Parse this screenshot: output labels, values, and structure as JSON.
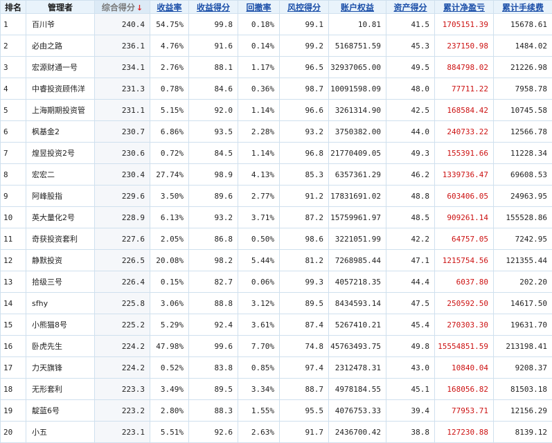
{
  "headers": {
    "rank": "排名",
    "manager": "管理者",
    "total_score": "综合得分",
    "return_rate": "收益率",
    "return_score": "收益得分",
    "drawdown": "回撤率",
    "risk_score": "风控得分",
    "equity": "账户权益",
    "asset_score": "资产得分",
    "net_profit": "累计净盈亏",
    "fees": "累计手续费"
  },
  "sort_indicator": "↓",
  "colors": {
    "header_bg": "#e9f3fb",
    "link": "#1a4ea8",
    "profit": "#cc1111",
    "sort_arrow": "#e02020"
  },
  "rows": [
    {
      "rank": "1",
      "manager": "百川爷",
      "total_score": "240.4",
      "return_rate": "54.75%",
      "return_score": "99.8",
      "drawdown": "0.18%",
      "risk_score": "99.1",
      "equity": "10.81",
      "asset_score": "41.5",
      "net_profit": "1705151.39",
      "fees": "15678.61"
    },
    {
      "rank": "2",
      "manager": "必由之路",
      "total_score": "236.1",
      "return_rate": "4.76%",
      "return_score": "91.6",
      "drawdown": "0.14%",
      "risk_score": "99.2",
      "equity": "5168751.59",
      "asset_score": "45.3",
      "net_profit": "237150.98",
      "fees": "1484.02"
    },
    {
      "rank": "3",
      "manager": "宏源财通一号",
      "total_score": "234.1",
      "return_rate": "2.76%",
      "return_score": "88.1",
      "drawdown": "1.17%",
      "risk_score": "96.5",
      "equity": "32937065.00",
      "asset_score": "49.5",
      "net_profit": "884798.02",
      "fees": "21226.98"
    },
    {
      "rank": "4",
      "manager": "中睿投资顾伟洋",
      "total_score": "231.3",
      "return_rate": "0.78%",
      "return_score": "84.6",
      "drawdown": "0.36%",
      "risk_score": "98.7",
      "equity": "10091598.09",
      "asset_score": "48.0",
      "net_profit": "77711.22",
      "fees": "7958.78"
    },
    {
      "rank": "5",
      "manager": "上海期期投资管",
      "total_score": "231.1",
      "return_rate": "5.15%",
      "return_score": "92.0",
      "drawdown": "1.14%",
      "risk_score": "96.6",
      "equity": "3261314.90",
      "asset_score": "42.5",
      "net_profit": "168584.42",
      "fees": "10745.58"
    },
    {
      "rank": "6",
      "manager": "枫基金2",
      "total_score": "230.7",
      "return_rate": "6.86%",
      "return_score": "93.5",
      "drawdown": "2.28%",
      "risk_score": "93.2",
      "equity": "3750382.00",
      "asset_score": "44.0",
      "net_profit": "240733.22",
      "fees": "12566.78"
    },
    {
      "rank": "7",
      "manager": "煌昱投资2号",
      "total_score": "230.6",
      "return_rate": "0.72%",
      "return_score": "84.5",
      "drawdown": "1.14%",
      "risk_score": "96.8",
      "equity": "21770409.05",
      "asset_score": "49.3",
      "net_profit": "155391.66",
      "fees": "11228.34"
    },
    {
      "rank": "8",
      "manager": "宏宏二",
      "total_score": "230.4",
      "return_rate": "27.74%",
      "return_score": "98.9",
      "drawdown": "4.13%",
      "risk_score": "85.3",
      "equity": "6357361.29",
      "asset_score": "46.2",
      "net_profit": "1339736.47",
      "fees": "69608.53"
    },
    {
      "rank": "9",
      "manager": "阿峰股指",
      "total_score": "229.6",
      "return_rate": "3.50%",
      "return_score": "89.6",
      "drawdown": "2.77%",
      "risk_score": "91.2",
      "equity": "17831691.02",
      "asset_score": "48.8",
      "net_profit": "603406.05",
      "fees": "24963.95"
    },
    {
      "rank": "10",
      "manager": "英大量化2号",
      "total_score": "228.9",
      "return_rate": "6.13%",
      "return_score": "93.2",
      "drawdown": "3.71%",
      "risk_score": "87.2",
      "equity": "15759961.97",
      "asset_score": "48.5",
      "net_profit": "909261.14",
      "fees": "155528.86"
    },
    {
      "rank": "11",
      "manager": "奇获投资套利",
      "total_score": "227.6",
      "return_rate": "2.05%",
      "return_score": "86.8",
      "drawdown": "0.50%",
      "risk_score": "98.6",
      "equity": "3221051.99",
      "asset_score": "42.2",
      "net_profit": "64757.05",
      "fees": "7242.95"
    },
    {
      "rank": "12",
      "manager": "静默投资",
      "total_score": "226.5",
      "return_rate": "20.08%",
      "return_score": "98.2",
      "drawdown": "5.44%",
      "risk_score": "81.2",
      "equity": "7268985.44",
      "asset_score": "47.1",
      "net_profit": "1215754.56",
      "fees": "121355.44"
    },
    {
      "rank": "13",
      "manager": "拾级三号",
      "total_score": "226.4",
      "return_rate": "0.15%",
      "return_score": "82.7",
      "drawdown": "0.06%",
      "risk_score": "99.3",
      "equity": "4057218.35",
      "asset_score": "44.4",
      "net_profit": "6037.80",
      "fees": "202.20"
    },
    {
      "rank": "14",
      "manager": "sfhy",
      "total_score": "225.8",
      "return_rate": "3.06%",
      "return_score": "88.8",
      "drawdown": "3.12%",
      "risk_score": "89.5",
      "equity": "8434593.14",
      "asset_score": "47.5",
      "net_profit": "250592.50",
      "fees": "14617.50"
    },
    {
      "rank": "15",
      "manager": "小熊猫8号",
      "total_score": "225.2",
      "return_rate": "5.29%",
      "return_score": "92.4",
      "drawdown": "3.61%",
      "risk_score": "87.4",
      "equity": "5267410.21",
      "asset_score": "45.4",
      "net_profit": "270303.30",
      "fees": "19631.70"
    },
    {
      "rank": "16",
      "manager": "卧虎先生",
      "total_score": "224.2",
      "return_rate": "47.98%",
      "return_score": "99.6",
      "drawdown": "7.70%",
      "risk_score": "74.8",
      "equity": "45763493.75",
      "asset_score": "49.8",
      "net_profit": "15554851.59",
      "fees": "213198.41"
    },
    {
      "rank": "17",
      "manager": "力天旗锋",
      "total_score": "224.2",
      "return_rate": "0.52%",
      "return_score": "83.8",
      "drawdown": "0.85%",
      "risk_score": "97.4",
      "equity": "2312478.31",
      "asset_score": "43.0",
      "net_profit": "10840.04",
      "fees": "9208.37"
    },
    {
      "rank": "18",
      "manager": "无形套利",
      "total_score": "223.3",
      "return_rate": "3.49%",
      "return_score": "89.5",
      "drawdown": "3.34%",
      "risk_score": "88.7",
      "equity": "4978184.55",
      "asset_score": "45.1",
      "net_profit": "168056.82",
      "fees": "81503.18"
    },
    {
      "rank": "19",
      "manager": "靛蓝6号",
      "total_score": "223.2",
      "return_rate": "2.80%",
      "return_score": "88.3",
      "drawdown": "1.55%",
      "risk_score": "95.5",
      "equity": "4076753.33",
      "asset_score": "39.4",
      "net_profit": "77953.71",
      "fees": "12156.29"
    },
    {
      "rank": "20",
      "manager": "小五",
      "total_score": "223.1",
      "return_rate": "5.51%",
      "return_score": "92.6",
      "drawdown": "2.63%",
      "risk_score": "91.7",
      "equity": "2436700.42",
      "asset_score": "38.8",
      "net_profit": "127230.88",
      "fees": "8139.12"
    }
  ]
}
